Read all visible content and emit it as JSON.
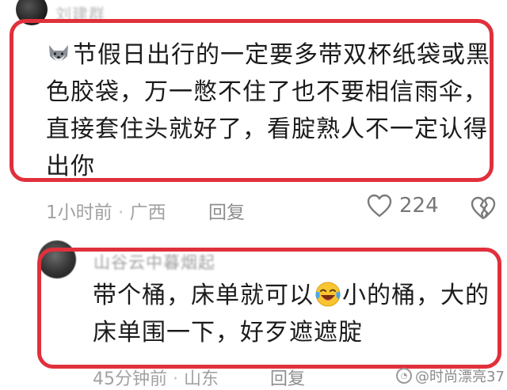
{
  "comments": [
    {
      "username": "刘建群",
      "text_lines": [
        "节假日出行的一定要多带双杯纸袋或黑",
        "色胶袋，万一憋不住了也不要相信雨伞，",
        "直接套住头就好了，看腚熟人不一定认得",
        "出你"
      ],
      "inline_emoji": "dog-face-emoji",
      "time": "1小时前",
      "separator": "·",
      "location": "广西",
      "reply_label": "回复",
      "likes": "224"
    },
    {
      "username": "山谷云中暮烟起",
      "text_lines_a": "带个桶，床单就可以",
      "inline_emoji": "laughing-tears-emoji",
      "text_lines_b": "小的桶，大的",
      "text_line_2": "床单围一下，好歹遮遮腚",
      "time": "45分钟前",
      "separator": "·",
      "location": "山东",
      "reply_label": "回复"
    }
  ],
  "watermark": {
    "text": "@时尚漂亮37"
  },
  "colors": {
    "highlight_border": "#e0303c",
    "body_text": "#1b1b1b",
    "meta_text": "#a2a2a2"
  }
}
